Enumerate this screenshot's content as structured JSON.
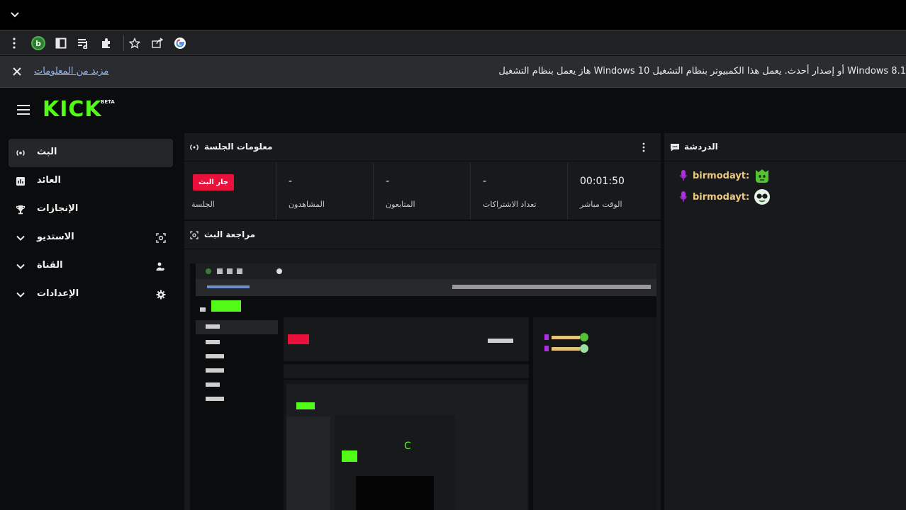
{
  "browser": {
    "profile_initial": "b",
    "icons": [
      "chevron-down-icon",
      "kebab-menu-icon",
      "reading-list-icon",
      "side-panel-icon",
      "media-icon",
      "extensions-icon",
      "star-icon",
      "share-icon",
      "google-icon"
    ]
  },
  "infobar": {
    "message": "هاز يعمل بنظام التشغيل Windows 10 أو إصدار أحدث. يعمل هذا الكمبيوتر بنظام التشغيل Windows 8.1",
    "link": "مزيد من المعلومات"
  },
  "app": {
    "logo": "KICK",
    "beta": "BETA",
    "sidebar": [
      {
        "label": "البث",
        "icon": "broadcast-icon",
        "active": true
      },
      {
        "label": "العائد",
        "icon": "dashboard-icon",
        "active": false
      },
      {
        "label": "الإنجازات",
        "icon": "trophy-icon",
        "active": false
      },
      {
        "label": "الاستديو",
        "icon": "studio-icon",
        "active": false
      },
      {
        "label": "القناة",
        "icon": "users-icon",
        "active": false
      },
      {
        "label": "الإعدادات",
        "icon": "gear-icon",
        "active": false
      }
    ],
    "session": {
      "title": "معلومات الجلسة",
      "stats": [
        {
          "value": "00:01:50",
          "caption": "الوقت مباشر"
        },
        {
          "value": "-",
          "caption": "تعداد الاشتراكات"
        },
        {
          "value": "-",
          "caption": "المتابعون"
        },
        {
          "value": "-",
          "caption": "المشاهدون"
        },
        {
          "badge": "جار البث",
          "caption": "الجلسة"
        }
      ]
    },
    "preview": {
      "title": "مراجعة البث"
    },
    "chat": {
      "title": "الدردشة",
      "messages": [
        {
          "user": "birmodayt:",
          "emote": "green-face-emote"
        },
        {
          "user": "birmodayt:",
          "emote": "glasses-face-emote"
        }
      ]
    }
  },
  "colors": {
    "brand": "#53fc18",
    "live": "#e9113c",
    "username": "#eec97e",
    "badge": "#b02fe0"
  }
}
